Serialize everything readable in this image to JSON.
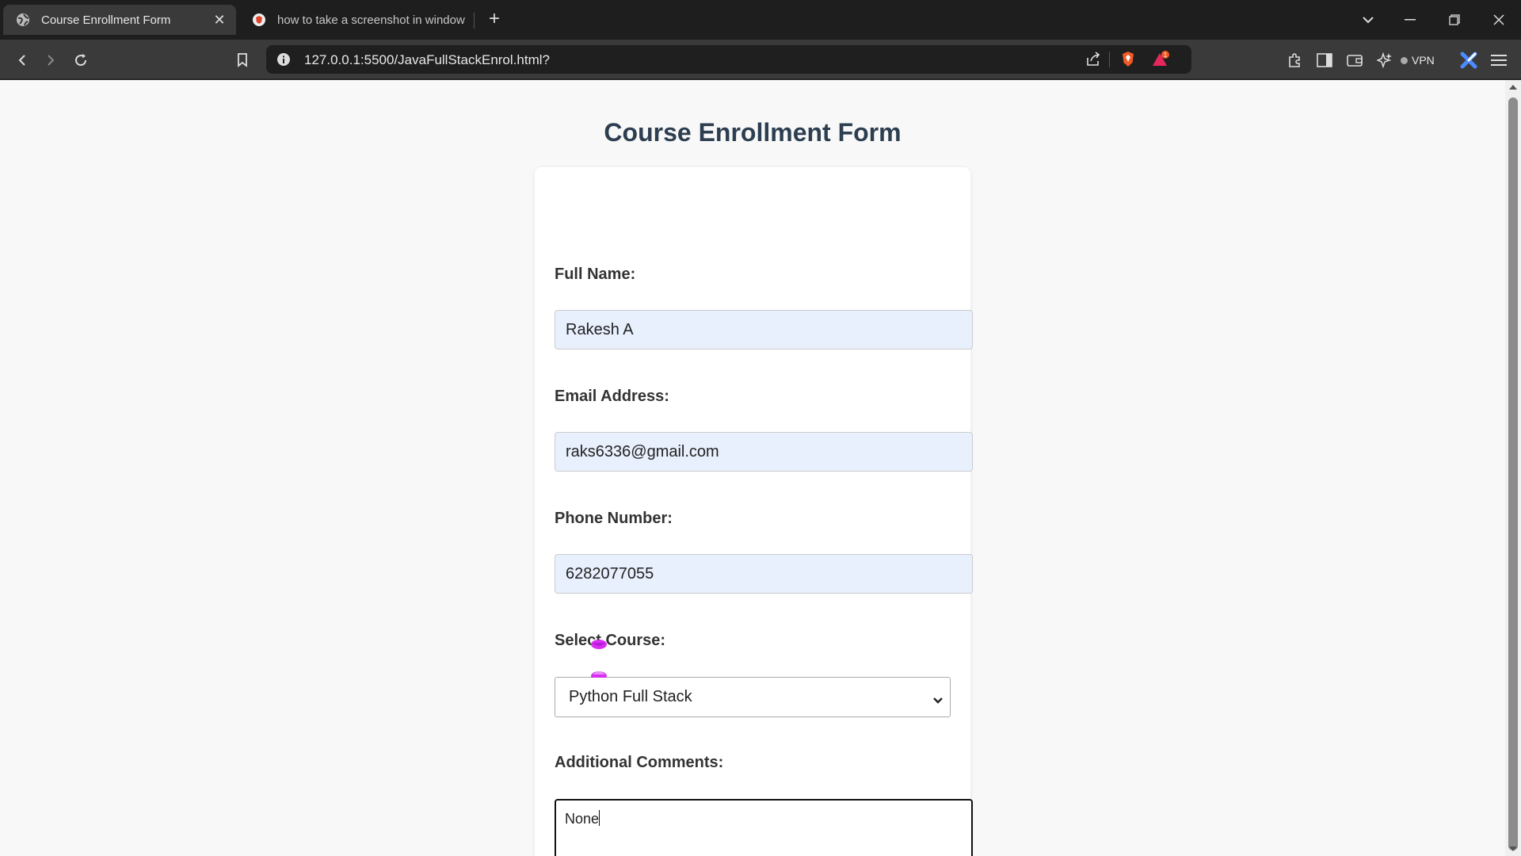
{
  "browser": {
    "tabs": [
      {
        "title": "Course Enrollment Form",
        "active": true
      },
      {
        "title": "how to take a screenshot in window",
        "active": false
      }
    ],
    "url": "127.0.0.1:5500/JavaFullStackEnrol.html?",
    "vpn_label": "VPN",
    "notification_count": "1"
  },
  "page": {
    "title": "Course Enrollment Form"
  },
  "form": {
    "full_name": {
      "label": "Full Name:",
      "value": "Rakesh A"
    },
    "email": {
      "label": "Email Address:",
      "value": "raks6336@gmail.com"
    },
    "phone": {
      "label": "Phone Number:",
      "value": "6282077055"
    },
    "course": {
      "label": "Select Course:",
      "selected": "Python Full Stack"
    },
    "comments": {
      "label": "Additional Comments:",
      "value": "None"
    }
  },
  "colors": {
    "title": "#2c3e50",
    "autofill_bg": "#e8f0fe",
    "page_bg": "#f8f8f8"
  }
}
